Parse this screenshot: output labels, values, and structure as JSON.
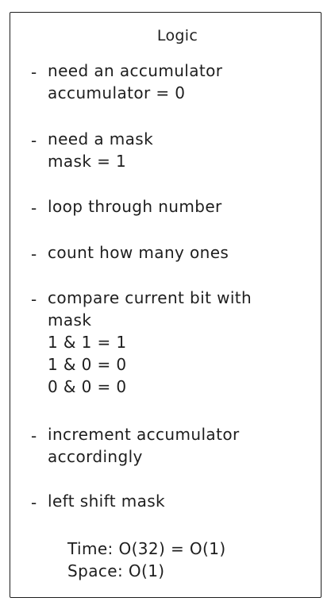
{
  "title": "Logic",
  "items": [
    {
      "dash": "-",
      "lines": [
        "need an accumulator",
        "accumulator = 0"
      ]
    },
    {
      "dash": "-",
      "lines": [
        "need a mask",
        "mask = 1"
      ]
    },
    {
      "dash": "-",
      "lines": [
        "loop through number"
      ]
    },
    {
      "dash": "-",
      "lines": [
        "count how many ones"
      ]
    },
    {
      "dash": "-",
      "lines": [
        "compare current bit with",
        "mask",
        "1 & 1 = 1",
        "1 & 0 = 0",
        "0 & 0 = 0"
      ]
    },
    {
      "dash": "-",
      "lines": [
        "increment accumulator",
        "accordingly"
      ]
    },
    {
      "dash": "-",
      "lines": [
        "left shift mask"
      ]
    }
  ],
  "complexity": {
    "time": "Time: O(32) = O(1)",
    "space": "Space: O(1)"
  }
}
